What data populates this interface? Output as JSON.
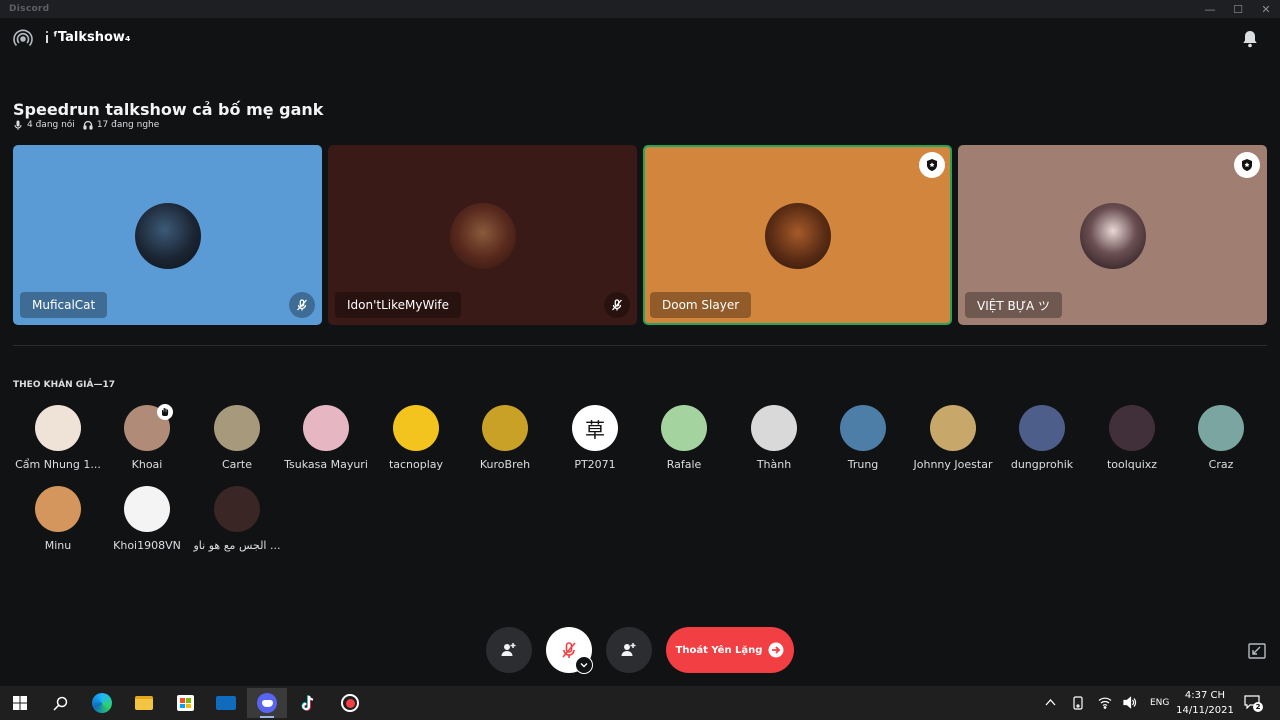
{
  "window": {
    "app_title": "Discord"
  },
  "header": {
    "channel_name": "ᶠTalkshow₄"
  },
  "stage": {
    "topic": "Speedrun talkshow cả bố mẹ gank",
    "speaking_count": "4 đang nói",
    "listening_count": "17 đang nghe"
  },
  "speakers": [
    {
      "name": "MuficalCat",
      "bg": "#5b9bd5",
      "muted": true,
      "moderator": false
    },
    {
      "name": "Idon'tLikeMyWife",
      "bg": "#3a1a16",
      "muted": true,
      "moderator": false
    },
    {
      "name": "Doom Slayer",
      "bg": "#d2853d",
      "muted": false,
      "moderator": true,
      "speaking": true
    },
    {
      "name": "VIỆT BỰA ツ",
      "bg": "#a07e71",
      "muted": false,
      "moderator": true
    }
  ],
  "audience": {
    "title": "THEO KHÁN GIẢ—17",
    "members": [
      {
        "name": "Cẩm Nhung 1...",
        "color": "#efe3d8"
      },
      {
        "name": "Khoai",
        "color": "#b08c78",
        "hand": true
      },
      {
        "name": "Carte",
        "color": "#a79a7c"
      },
      {
        "name": "Tsukasa Mayuri",
        "color": "#e6b7c3"
      },
      {
        "name": "tacnoplay",
        "color": "#f2c41d"
      },
      {
        "name": "KuroBreh",
        "color": "#c9a127"
      },
      {
        "name": "PT2071",
        "color": "#ffffff",
        "glyph": "草"
      },
      {
        "name": "Rafale",
        "color": "#a5d3a0"
      },
      {
        "name": "Thành",
        "color": "#d9d9d9"
      },
      {
        "name": "Trung",
        "color": "#4c7ea8"
      },
      {
        "name": "Johnny Joestar",
        "color": "#c8a86a"
      },
      {
        "name": "dungprohik",
        "color": "#4d5e8b"
      },
      {
        "name": "toolquixz",
        "color": "#41303a"
      },
      {
        "name": "Craz",
        "color": "#7aa5a0"
      },
      {
        "name": "Minu",
        "color": "#d4965d"
      },
      {
        "name": "Khoi1908VN",
        "color": "#f4f4f4"
      },
      {
        "name": "الجس مع هو ناو ...",
        "color": "#3a2624"
      }
    ]
  },
  "controls": {
    "leave_label": "Thoát Yên Lặng"
  },
  "taskbar": {
    "language": "ENG",
    "time": "4:37 CH",
    "date": "14/11/2021",
    "notification_count": "2"
  }
}
